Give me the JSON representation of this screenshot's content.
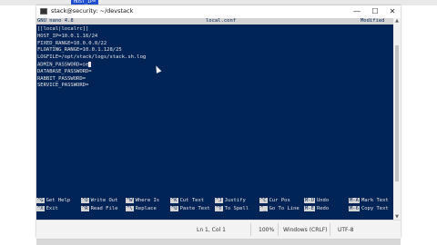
{
  "background_strip": {
    "tag": "HOST_IP="
  },
  "window": {
    "title": "stack@security: ~/devstack",
    "controls": {
      "minimize": "—",
      "maximize": "☐",
      "close": "✕"
    }
  },
  "nano": {
    "header": {
      "version": "GNU nano 4.8",
      "filename": "local.conf",
      "state": "Modified"
    },
    "lines": [
      "[[local|localrc]]",
      "HOST_IP=10.0.1.16/24",
      "FIXED_RANGE=10.0.0.0/22",
      "FLOATING_RANGE=10.0.1.128/25",
      "LOGFILE=/opt/stack/logs/stack.sh.log",
      "ADMIN_PASSWORD=se",
      "DATABASE_PASSWORD=",
      "RABBIT_PASSWORD=",
      "SERVICE_PASSWORD="
    ],
    "shortcuts_row1": [
      {
        "key": "^G",
        "label": "Get Help"
      },
      {
        "key": "^O",
        "label": "Write Out"
      },
      {
        "key": "^W",
        "label": "Where Is"
      },
      {
        "key": "^K",
        "label": "Cut Text"
      },
      {
        "key": "^J",
        "label": "Justify"
      },
      {
        "key": "^C",
        "label": "Cur Pos"
      },
      {
        "key": "M-U",
        "label": "Undo"
      },
      {
        "key": "M-A",
        "label": "Mark Text"
      }
    ],
    "shortcuts_row2": [
      {
        "key": "^X",
        "label": "Exit"
      },
      {
        "key": "^R",
        "label": "Read File"
      },
      {
        "key": "^\\",
        "label": "Replace"
      },
      {
        "key": "^U",
        "label": "Paste Text"
      },
      {
        "key": "^T",
        "label": "To Spell"
      },
      {
        "key": "^_",
        "label": "Go To Line"
      },
      {
        "key": "M-E",
        "label": "Redo"
      },
      {
        "key": "M-6",
        "label": "Copy Text"
      }
    ]
  },
  "statusbar": {
    "position": "Ln 1, Col 1",
    "zoom": "100%",
    "line_ending": "Windows (CRLF)",
    "encoding": "UTF-8"
  },
  "colors": {
    "terminal_bg": "#012456",
    "terminal_fg": "#e6e6e6",
    "header_bg": "#d4d4d4"
  }
}
